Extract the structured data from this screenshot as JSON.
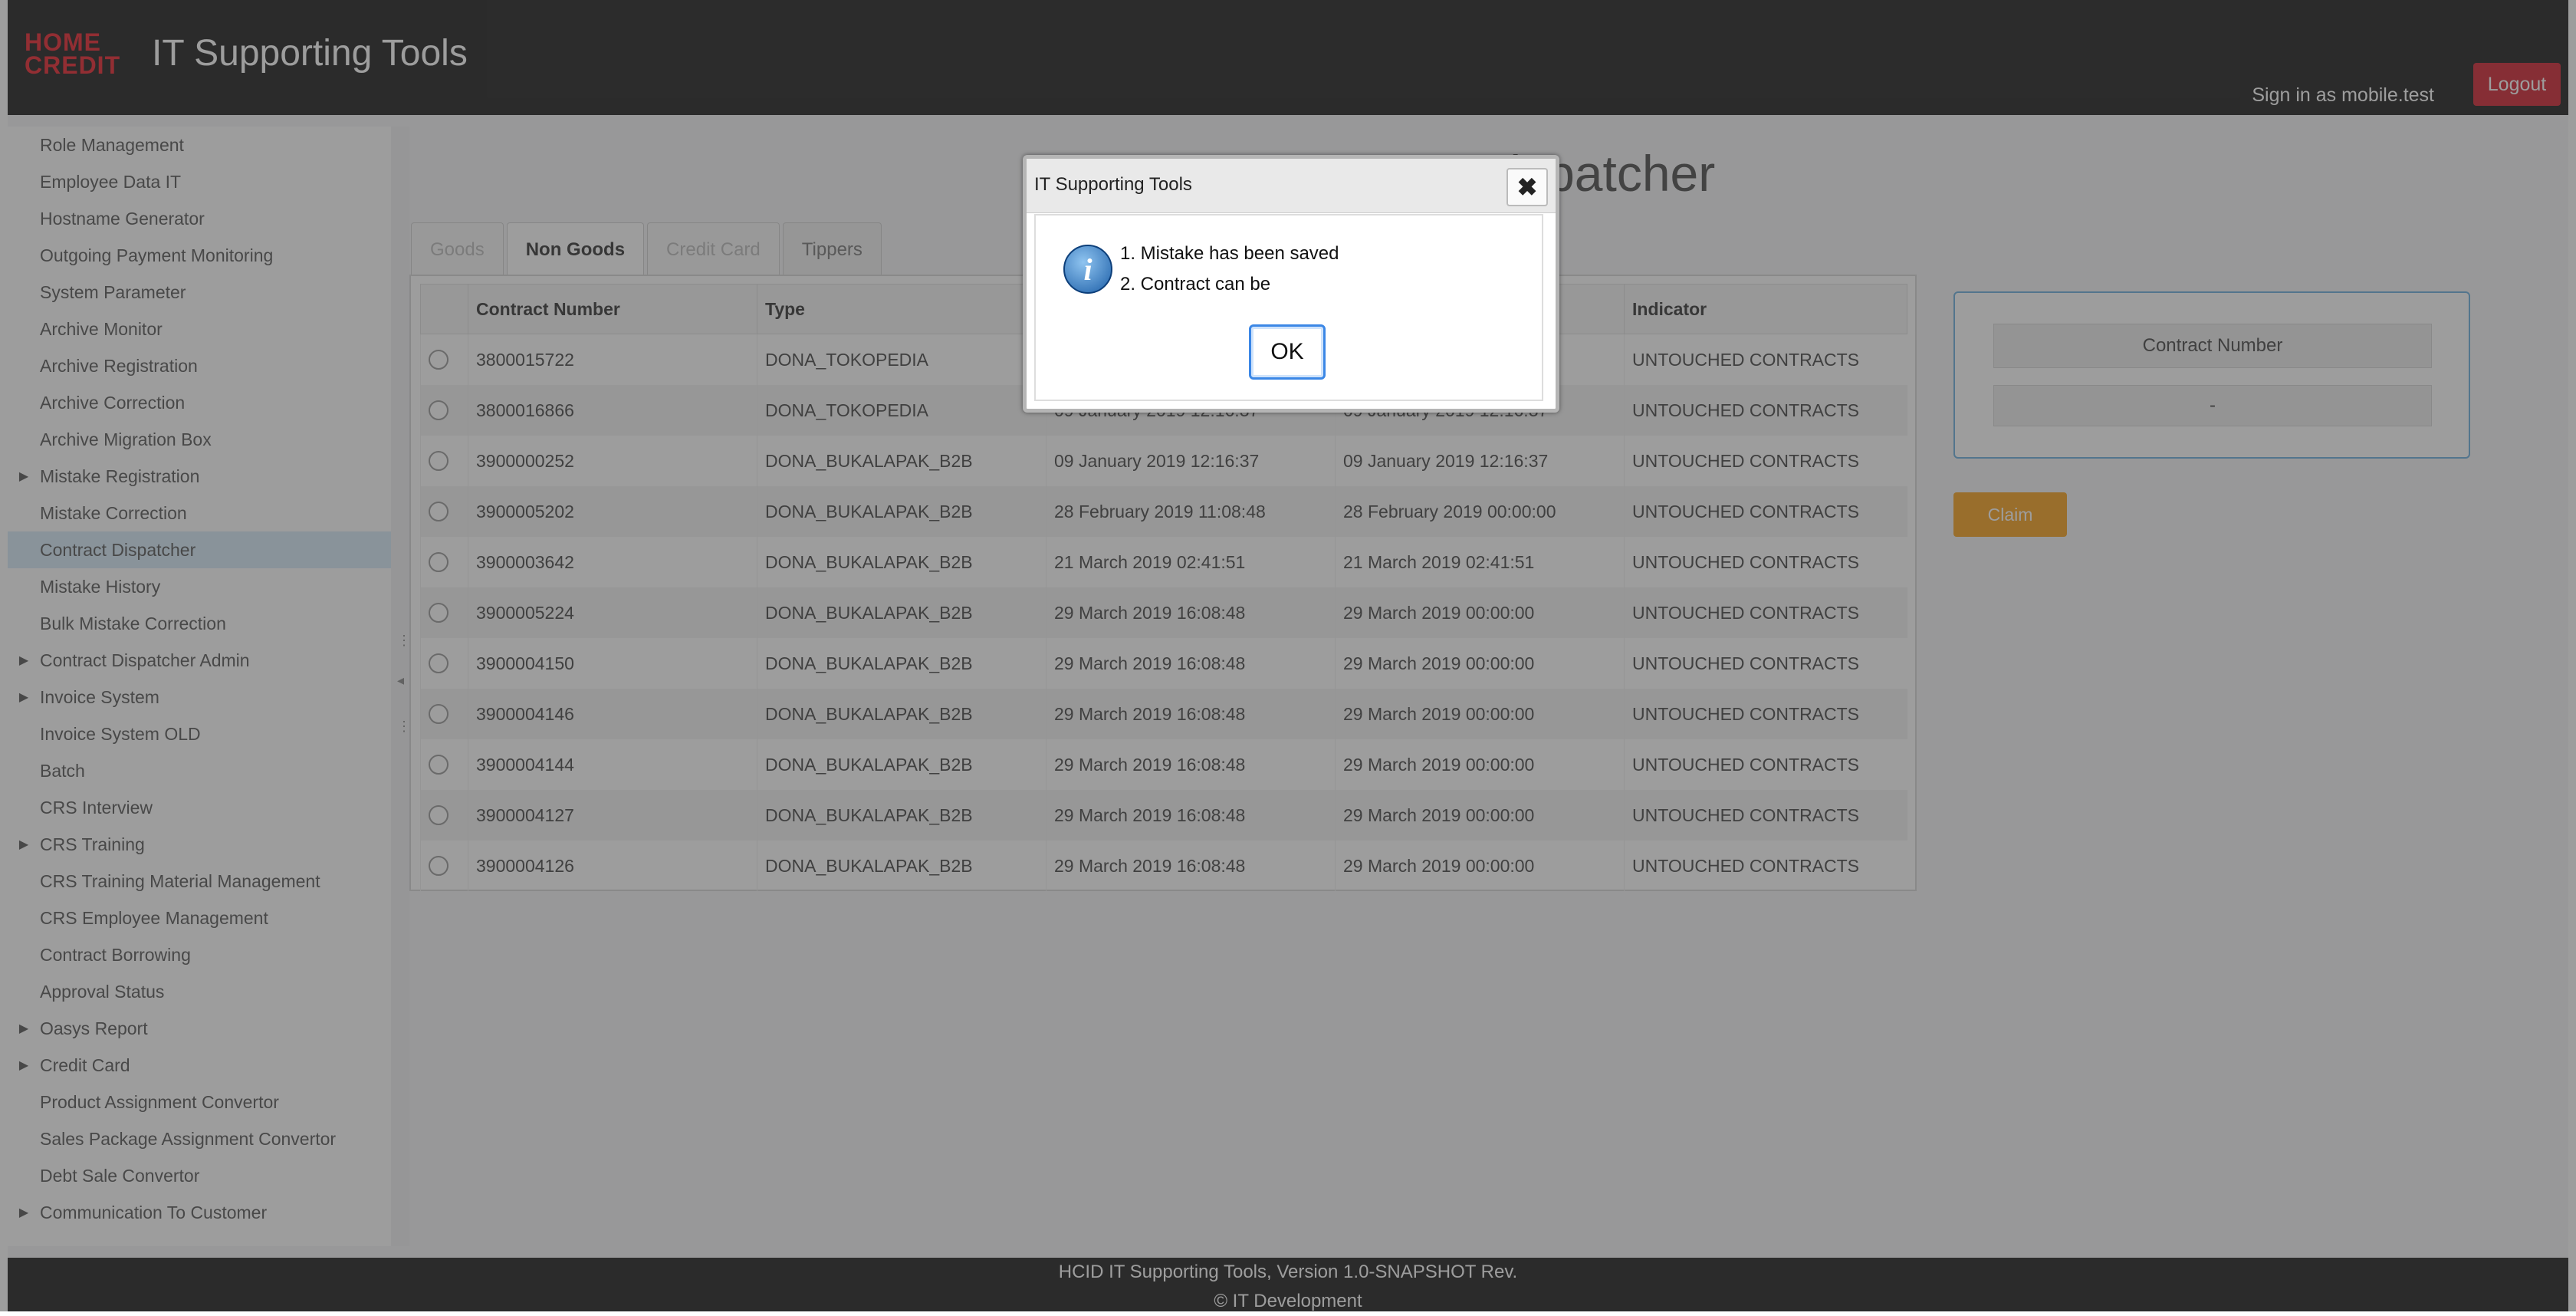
{
  "header": {
    "logo_line1": "HOME",
    "logo_line2": "CREDIT",
    "app_title": "IT Supporting Tools",
    "signin_text": "Sign in as mobile.test",
    "logout_label": "Logout"
  },
  "sidebar": {
    "items": [
      {
        "label": "Role Management",
        "expandable": false
      },
      {
        "label": "Employee Data IT",
        "expandable": false
      },
      {
        "label": "Hostname Generator",
        "expandable": false
      },
      {
        "label": "Outgoing Payment Monitoring",
        "expandable": false
      },
      {
        "label": "System Parameter",
        "expandable": false
      },
      {
        "label": "Archive Monitor",
        "expandable": false
      },
      {
        "label": "Archive Registration",
        "expandable": false
      },
      {
        "label": "Archive Correction",
        "expandable": false
      },
      {
        "label": "Archive Migration Box",
        "expandable": false
      },
      {
        "label": "Mistake Registration",
        "expandable": true
      },
      {
        "label": "Mistake Correction",
        "expandable": false
      },
      {
        "label": "Contract Dispatcher",
        "expandable": false,
        "active": true
      },
      {
        "label": "Mistake History",
        "expandable": false
      },
      {
        "label": "Bulk Mistake Correction",
        "expandable": false
      },
      {
        "label": "Contract Dispatcher Admin",
        "expandable": true
      },
      {
        "label": "Invoice System",
        "expandable": true
      },
      {
        "label": "Invoice System OLD",
        "expandable": false
      },
      {
        "label": "Batch",
        "expandable": false
      },
      {
        "label": "CRS Interview",
        "expandable": false
      },
      {
        "label": "CRS Training",
        "expandable": true
      },
      {
        "label": "CRS Training Material Management",
        "expandable": false
      },
      {
        "label": "CRS Employee Management",
        "expandable": false
      },
      {
        "label": "Contract Borrowing",
        "expandable": false
      },
      {
        "label": "Approval Status",
        "expandable": false
      },
      {
        "label": "Oasys Report",
        "expandable": true
      },
      {
        "label": "Credit Card",
        "expandable": true
      },
      {
        "label": "Product Assignment Convertor",
        "expandable": false
      },
      {
        "label": "Sales Package Assignment Convertor",
        "expandable": false
      },
      {
        "label": "Debt Sale Convertor",
        "expandable": false
      },
      {
        "label": "Communication To Customer",
        "expandable": true
      }
    ]
  },
  "main": {
    "page_title": "Contract Dispatcher",
    "tabs": [
      {
        "label": "Goods",
        "state": "disabled"
      },
      {
        "label": "Non Goods",
        "state": "active"
      },
      {
        "label": "Credit Card",
        "state": "disabled"
      },
      {
        "label": "Tippers",
        "state": "normal"
      }
    ],
    "table": {
      "columns": [
        "",
        "Contract Number",
        "Type",
        "",
        "",
        "Indicator"
      ],
      "rows": [
        [
          "3800015722",
          "DONA_TOKOPEDIA",
          "",
          "",
          "UNTOUCHED CONTRACTS"
        ],
        [
          "3800016866",
          "DONA_TOKOPEDIA",
          "09 January 2019 12:16:37",
          "09 January 2019 12:16:37",
          "UNTOUCHED CONTRACTS"
        ],
        [
          "3900000252",
          "DONA_BUKALAPAK_B2B",
          "09 January 2019 12:16:37",
          "09 January 2019 12:16:37",
          "UNTOUCHED CONTRACTS"
        ],
        [
          "3900005202",
          "DONA_BUKALAPAK_B2B",
          "28 February 2019 11:08:48",
          "28 February 2019 00:00:00",
          "UNTOUCHED CONTRACTS"
        ],
        [
          "3900003642",
          "DONA_BUKALAPAK_B2B",
          "21 March 2019 02:41:51",
          "21 March 2019 02:41:51",
          "UNTOUCHED CONTRACTS"
        ],
        [
          "3900005224",
          "DONA_BUKALAPAK_B2B",
          "29 March 2019 16:08:48",
          "29 March 2019 00:00:00",
          "UNTOUCHED CONTRACTS"
        ],
        [
          "3900004150",
          "DONA_BUKALAPAK_B2B",
          "29 March 2019 16:08:48",
          "29 March 2019 00:00:00",
          "UNTOUCHED CONTRACTS"
        ],
        [
          "3900004146",
          "DONA_BUKALAPAK_B2B",
          "29 March 2019 16:08:48",
          "29 March 2019 00:00:00",
          "UNTOUCHED CONTRACTS"
        ],
        [
          "3900004144",
          "DONA_BUKALAPAK_B2B",
          "29 March 2019 16:08:48",
          "29 March 2019 00:00:00",
          "UNTOUCHED CONTRACTS"
        ],
        [
          "3900004127",
          "DONA_BUKALAPAK_B2B",
          "29 March 2019 16:08:48",
          "29 March 2019 00:00:00",
          "UNTOUCHED CONTRACTS"
        ],
        [
          "3900004126",
          "DONA_BUKALAPAK_B2B",
          "29 March 2019 16:08:48",
          "29 March 2019 00:00:00",
          "UNTOUCHED CONTRACTS"
        ]
      ]
    },
    "side_panel": {
      "header": "Contract Number",
      "value": "-"
    },
    "claim_label": "Claim"
  },
  "footer": {
    "line1": "HCID IT Supporting Tools, Version 1.0-SNAPSHOT Rev.",
    "line2": "© IT Development"
  },
  "dialog": {
    "title": "IT Supporting Tools",
    "close_glyph": "✖",
    "icon_glyph": "i",
    "message_line1": "1. Mistake has been saved",
    "message_line2": "2. Contract can be",
    "ok_label": "OK"
  }
}
